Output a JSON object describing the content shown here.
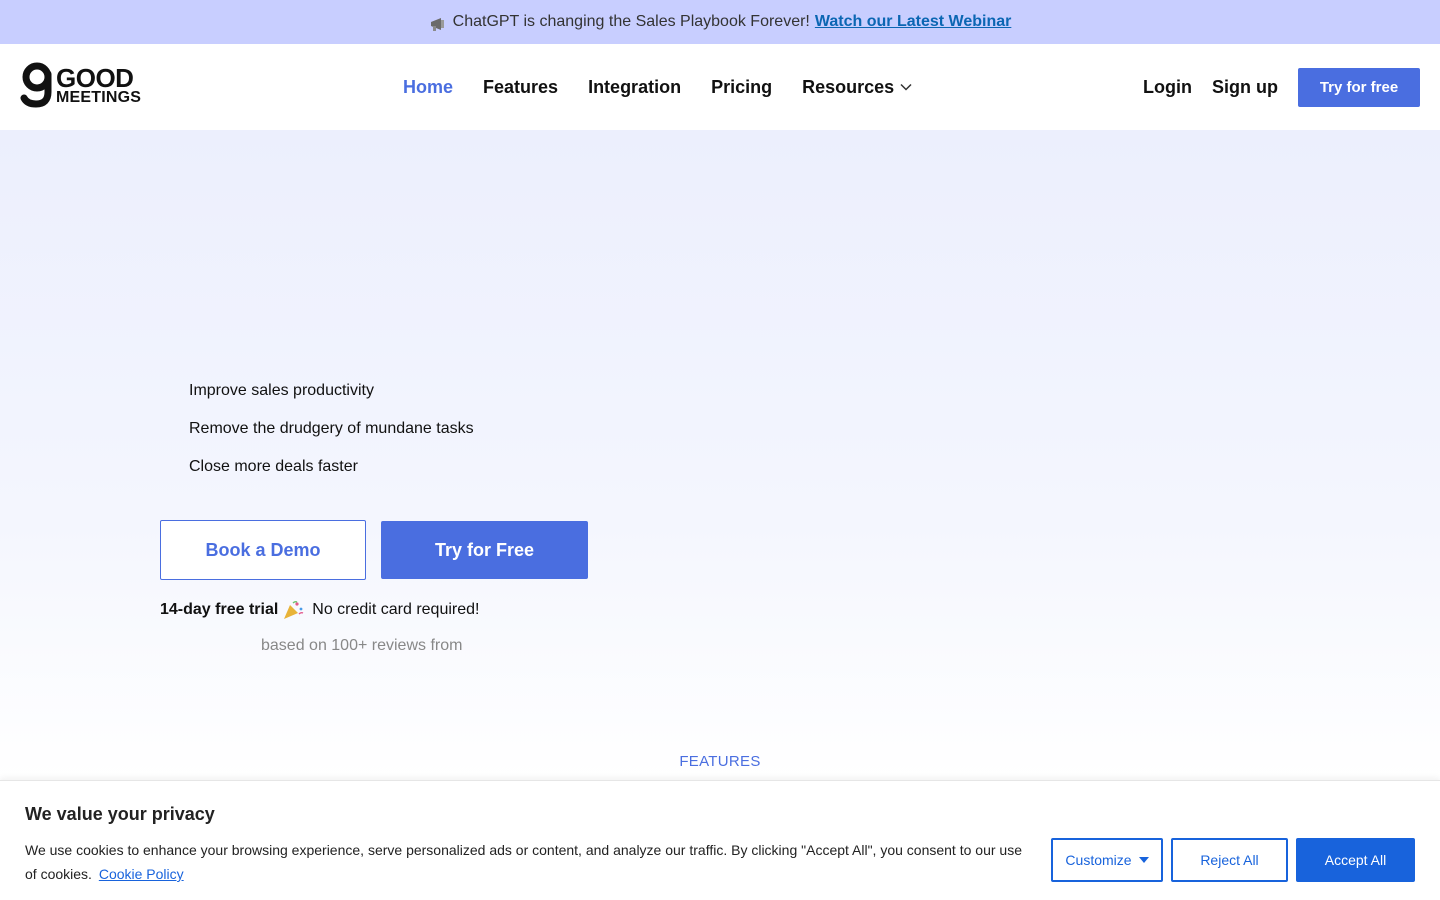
{
  "announcement": {
    "text": "ChatGPT is changing the Sales Playbook Forever!",
    "link": "Watch our Latest Webinar",
    "icon": "megaphone-icon"
  },
  "header": {
    "logo_line1": "GOOD",
    "logo_line2": "MEETINGS",
    "nav": [
      {
        "label": "Home",
        "active": true
      },
      {
        "label": "Features"
      },
      {
        "label": "Integration"
      },
      {
        "label": "Pricing"
      },
      {
        "label": "Resources",
        "has_dropdown": true
      }
    ],
    "login": "Login",
    "signup": "Sign up",
    "try_button": "Try for free"
  },
  "hero": {
    "bullets": [
      "Improve sales productivity",
      "Remove the drudgery of mundane tasks",
      "Close more deals faster"
    ],
    "demo_button": "Book a Demo",
    "free_button": "Try for Free",
    "trial_strong": "14-day free trial",
    "trial_icon": "party-popper-icon",
    "trial_rest": "No credit card required!",
    "reviews": "based on 100+ reviews from"
  },
  "features_label": "FEATURES",
  "cookie": {
    "title": "We value your privacy",
    "text": "We use cookies to enhance your browsing experience, serve personalized ads or content, and analyze our traffic. By clicking \"Accept All\", you consent to our use of cookies.",
    "policy_link": "Cookie Policy",
    "customize": "Customize",
    "reject": "Reject All",
    "accept": "Accept All"
  },
  "colors": {
    "primary": "#4a6ee0",
    "announcement_bg": "#c8ceff",
    "cookie_accent": "#1863dc"
  }
}
